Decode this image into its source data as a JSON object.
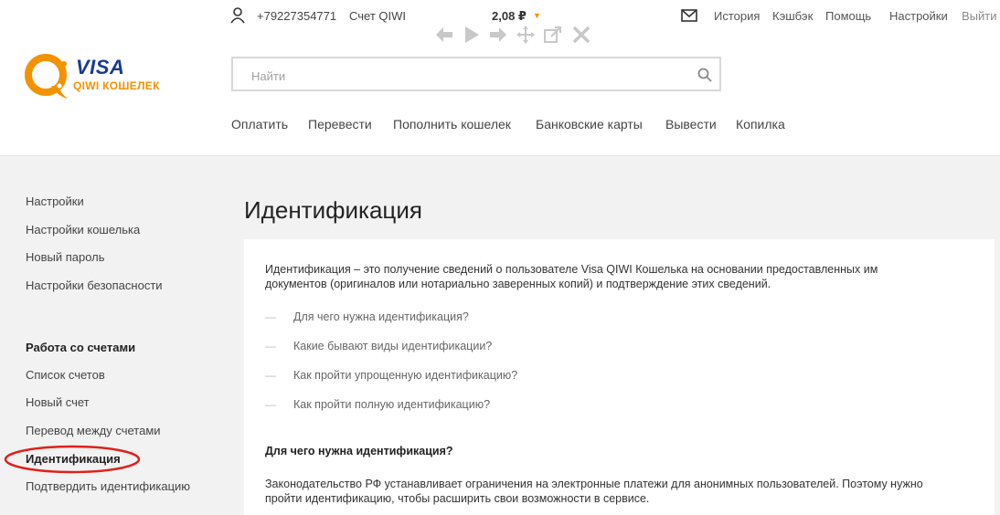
{
  "logo": {
    "visa": "VISA",
    "wallet": "QIWI КОШЕЛЕК"
  },
  "topbar": {
    "phone": "+79227354771",
    "account": "Счет QIWI",
    "balance": "2,08 ₽",
    "links": [
      "История",
      "Кэшбэк",
      "Помощь",
      "Настройки",
      "Выйти"
    ]
  },
  "search": {
    "placeholder": "Найти"
  },
  "nav": [
    "Оплатить",
    "Перевести",
    "Пополнить кошелек",
    "Банковские карты",
    "Вывести",
    "Копилка"
  ],
  "sidebar": {
    "settings": [
      "Настройки",
      "Настройки кошелька",
      "Новый пароль",
      "Настройки безопасности"
    ],
    "accounts_heading": "Работа со счетами",
    "accounts": [
      "Список счетов",
      "Новый счет",
      "Перевод между счетами",
      "Идентификация",
      "Подтвердить идентификацию"
    ]
  },
  "content": {
    "title": "Идентификация",
    "intro": "Идентификация – это получение сведений о пользователе Visa QIWI Кошелька на основании предоставленных им документов (оригиналов или нотариально заверенных копий) и подтверждение этих сведений.",
    "toc": [
      "Для чего нужна идентификация?",
      "Какие бывают виды идентификации?",
      "Как пройти упрощенную идентификацию?",
      "Как пройти полную идентификацию?"
    ],
    "section_heading": "Для чего нужна идентификация?",
    "section_text": "Законодательство РФ устанавливает ограничения на электронные платежи для анонимных пользователей. Поэтому нужно пройти идентификацию, чтобы расширить свои возможности в сервисе."
  },
  "colors": {
    "brand_orange": "#f39200",
    "brand_blue": "#1a3b8f",
    "highlight_red": "#e0201b",
    "body_bg": "#f2f2f2"
  }
}
